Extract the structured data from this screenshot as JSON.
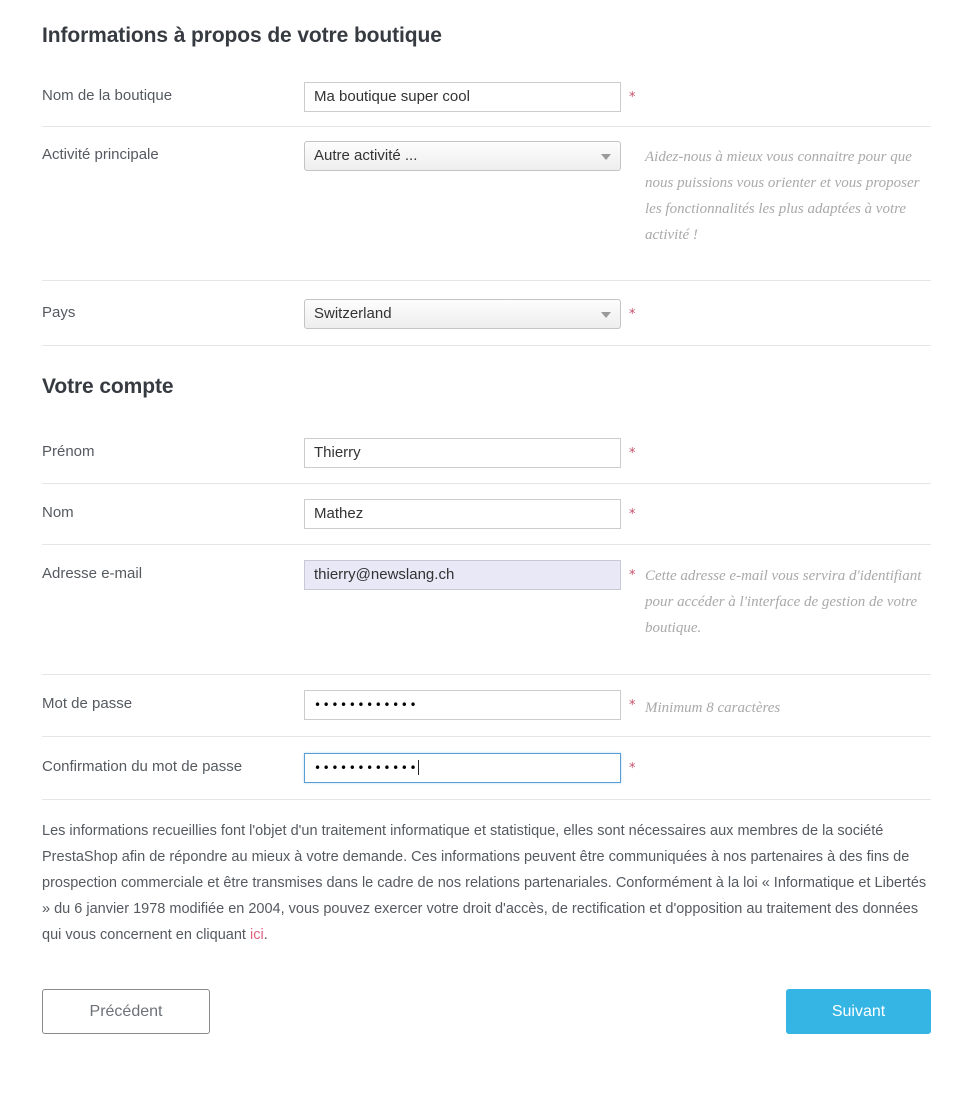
{
  "shop_section": {
    "title": "Informations à propos de votre boutique",
    "fields": [
      {
        "label": "Nom de la boutique",
        "type": "text",
        "value": "Ma boutique super cool",
        "required_mark": "*",
        "help": ""
      },
      {
        "label": "Activité principale",
        "type": "select",
        "value": "Autre activité ...",
        "required_mark": "",
        "help": "Aidez-nous à mieux vous connaitre pour que nous puissions vous orienter et vous proposer les fonctionnalités les plus adaptées à votre activité !"
      },
      {
        "label": "Pays",
        "type": "select",
        "value": "Switzerland",
        "required_mark": "*",
        "help": ""
      }
    ]
  },
  "account_section": {
    "title": "Votre compte",
    "fields": [
      {
        "label": "Prénom",
        "type": "text",
        "value": "Thierry",
        "required_mark": "*",
        "help": ""
      },
      {
        "label": "Nom",
        "type": "text",
        "value": "Mathez",
        "required_mark": "*",
        "help": ""
      },
      {
        "label": "Adresse e-mail",
        "type": "email",
        "value": "thierry@newslang.ch",
        "required_mark": "*",
        "help": "Cette adresse e-mail vous servira d'identifiant pour accéder à l'interface de gestion de votre boutique."
      },
      {
        "label": "Mot de passe",
        "type": "password",
        "value": "••••••••••••",
        "required_mark": "*",
        "help": "Minimum 8 caractères"
      },
      {
        "label": "Confirmation du mot de passe",
        "type": "password",
        "value": "••••••••••••",
        "required_mark": "*",
        "help": ""
      }
    ]
  },
  "legal": {
    "text_before_link": "Les informations recueillies font l'objet d'un traitement informatique et statistique, elles sont nécessaires aux membres de la société PrestaShop afin de répondre au mieux à votre demande. Ces informations peuvent être communiquées à nos partenaires à des fins de prospection commerciale et être transmises dans le cadre de nos relations partenariales. Conformément à la loi « Informatique et Libertés » du 6 janvier 1978 modifiée en 2004, vous pouvez exercer votre droit d'accès, de rectification et d'opposition au traitement des données qui vous concernent en cliquant ",
    "link_text": "ici",
    "text_after_link": "."
  },
  "footer": {
    "previous_label": "Précédent",
    "next_label": "Suivant"
  },
  "icons": {
    "dropdown_arrow": "chevron-down-icon"
  },
  "colors": {
    "accent_blue": "#34b5e4",
    "required_star": "#c4506a",
    "link_pink": "#e0607f",
    "autofill_bg": "#e8e8f7",
    "focus_border": "#5a9fd4"
  }
}
